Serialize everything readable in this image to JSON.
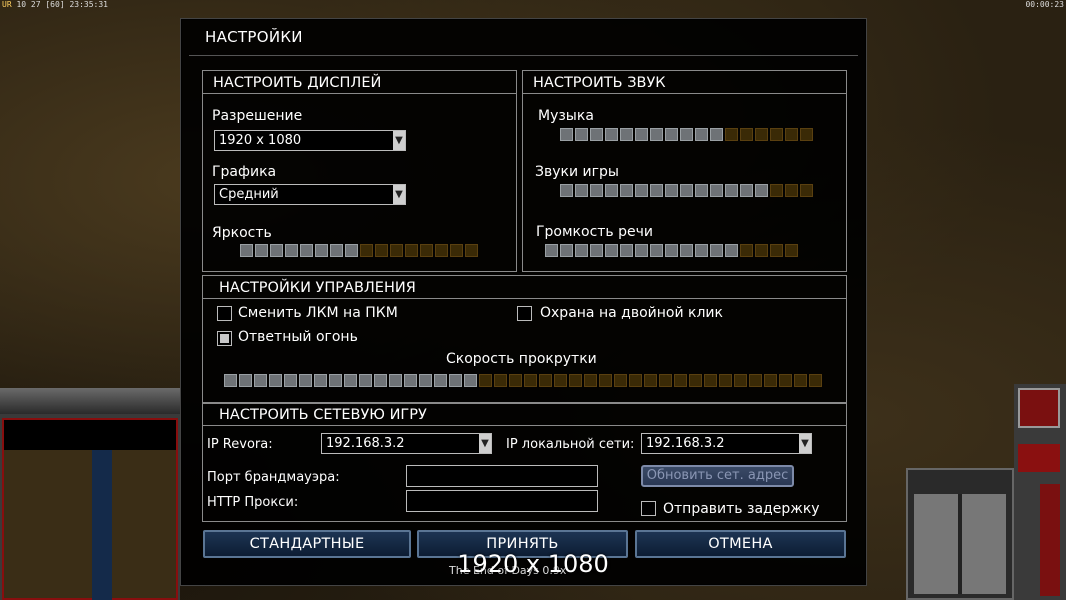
{
  "hud": {
    "top_left_ur": "UR",
    "top_left_stats": "10 27 [60] 23:35:31",
    "top_right_time": "00:00:23"
  },
  "dialog": {
    "title": "НАСТРОЙКИ",
    "display": {
      "heading": "НАСТРОИТЬ ДИСПЛЕЙ",
      "resolution_label": "Разрешение",
      "resolution_value": "1920 x 1080",
      "graphics_label": "Графика",
      "graphics_value": "Средний",
      "brightness_label": "Яркость",
      "brightness_level": 0.5
    },
    "sound": {
      "heading": "НАСТРОИТЬ ЗВУК",
      "music_label": "Музыка",
      "music_level": 0.65,
      "sfx_label": "Звуки игры",
      "sfx_level": 0.85,
      "voice_label": "Громкость речи",
      "voice_level": 0.75
    },
    "controls": {
      "heading": "НАСТРОЙКИ УПРАВЛЕНИЯ",
      "swap_mouse_label": "Сменить ЛКМ на ПКМ",
      "swap_mouse_checked": false,
      "retaliation_label": "Ответный огонь",
      "retaliation_checked": true,
      "double_click_guard_label": "Охрана на двойной клик",
      "double_click_guard_checked": false,
      "scroll_speed_label": "Скорость прокрутки",
      "scroll_speed_level": 0.42
    },
    "network": {
      "heading": "НАСТРОИТЬ СЕТЕВУЮ ИГРУ",
      "ip_revora_label": "IP Revora:",
      "ip_revora_value": "192.168.3.2",
      "ip_local_label": "IP локальной сети:",
      "ip_local_value": "192.168.3.2",
      "firewall_port_label": "Порт брандмауэра:",
      "firewall_port_value": "",
      "http_proxy_label": "HTTP Прокси:",
      "http_proxy_value": "",
      "refresh_button": "Обновить сет. адрес",
      "send_delay_label": "Отправить задержку",
      "send_delay_checked": false
    },
    "buttons": {
      "defaults": "СТАНДАРТНЫЕ",
      "accept": "ПРИНЯТЬ",
      "cancel": "ОТМЕНА"
    }
  },
  "overlay_resolution": "1920 x 1080",
  "footer_text": "The End of Days 0.9x"
}
